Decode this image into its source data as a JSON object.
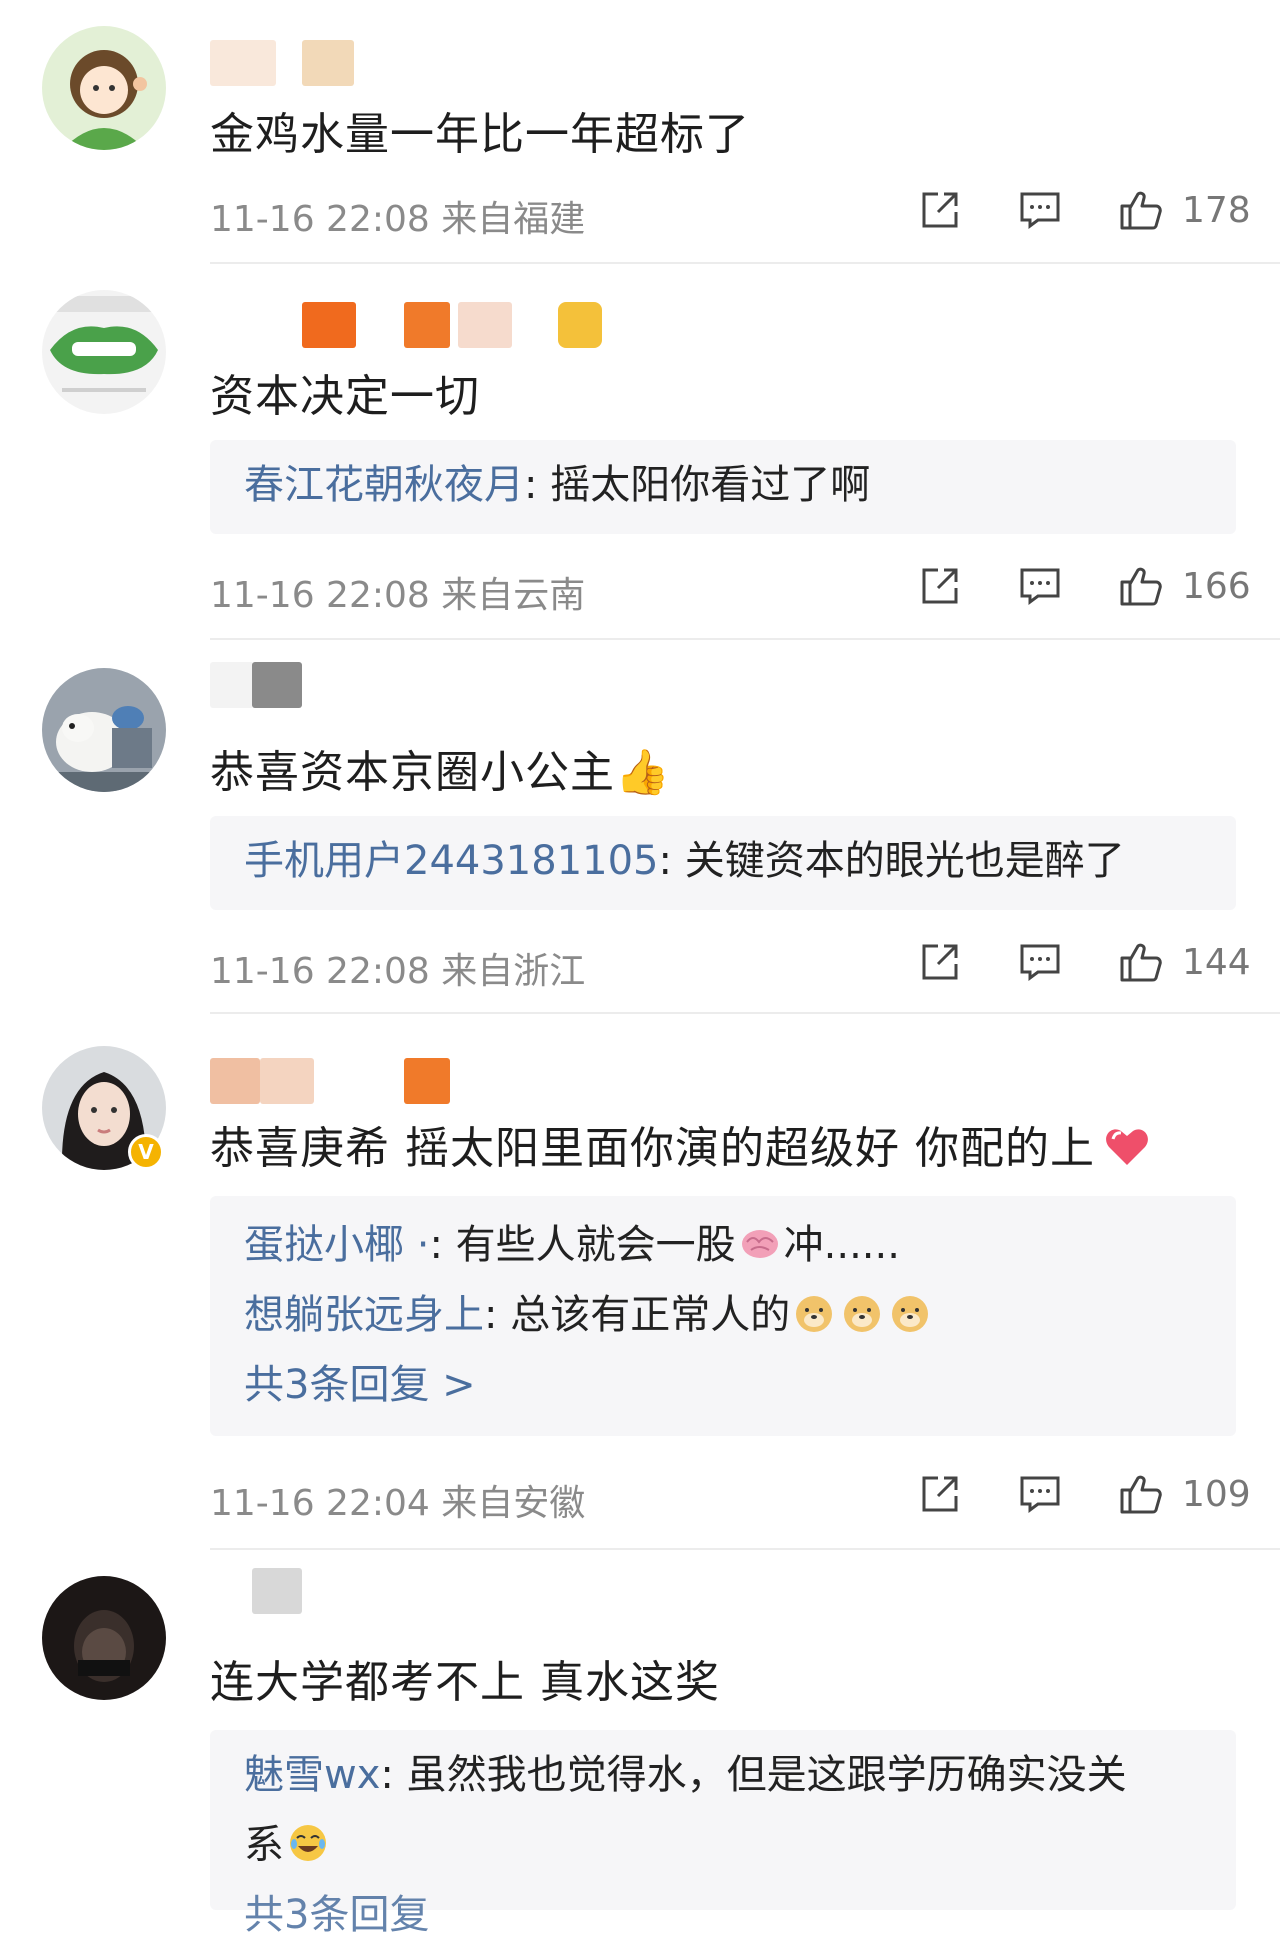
{
  "comments": [
    {
      "text": "金鸡水量一年比一年超标了",
      "time": "11-16 22:08 来自福建",
      "likes": "178",
      "replies": [],
      "more": ""
    },
    {
      "text": "资本决定一切",
      "time": "11-16 22:08 来自云南",
      "likes": "166",
      "replies": [
        {
          "name": "春江花朝秋夜月",
          "text": ": 摇太阳你看过了啊"
        }
      ],
      "more": ""
    },
    {
      "text": "恭喜资本京圈小公主",
      "emoji": "👍",
      "time": "11-16 22:08 来自浙江",
      "likes": "144",
      "replies": [
        {
          "name": "手机用户2443181105",
          "text": ": 关键资本的眼光也是醉了"
        }
      ],
      "more": ""
    },
    {
      "text": "恭喜庚希 摇太阳里面你演的超级好 你配的上",
      "time": "11-16 22:04 来自安徽",
      "likes": "109",
      "replies": [
        {
          "name": "蛋挞小椰 ·",
          "text": ": 有些人就会一股",
          "text_after": "冲......"
        },
        {
          "name": "想躺张远身上",
          "text": ": 总该有正常人的"
        }
      ],
      "more": "共3条回复 >"
    },
    {
      "text": "连大学都考不上 真水这奖",
      "replies": [
        {
          "name": "魅雪wx",
          "text": ": 虽然我也觉得水，但是这跟学历确实没关",
          "text_line2": "系"
        }
      ],
      "more": "共3条回复"
    }
  ],
  "icons": {
    "share": "share-icon",
    "comment": "comment-icon",
    "like": "thumbs-up-icon"
  },
  "colors": {
    "reply_name": "#4a6e9e",
    "meta_text": "#8a8a8a",
    "reply_bg": "#f6f6f8"
  }
}
